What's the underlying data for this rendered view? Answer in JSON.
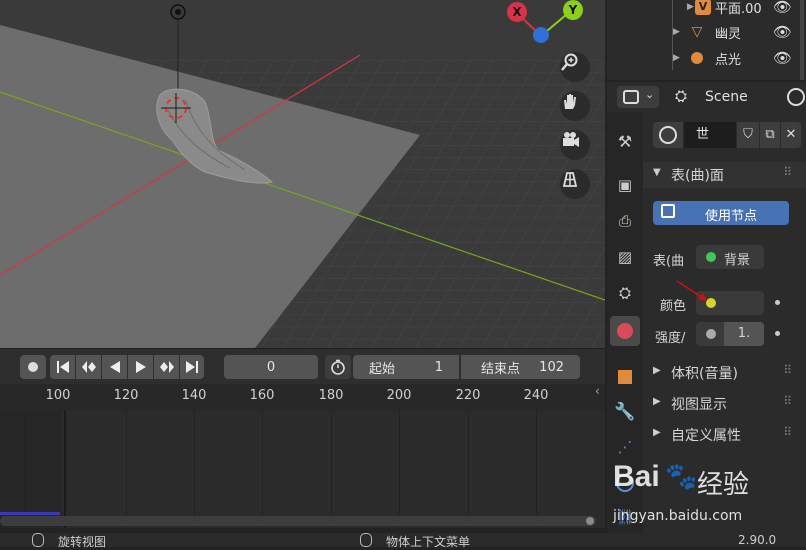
{
  "viewport": {
    "gizmo": {
      "x_label": "X",
      "y_label": "Y"
    },
    "nav_icons": [
      "zoom-icon",
      "hand-pan-icon",
      "camera-icon",
      "grid-ortho-icon"
    ]
  },
  "timeline": {
    "current_frame": "0",
    "start_label": "起始",
    "start_value": "1",
    "end_label": "结束点",
    "end_value": "102",
    "ruler_ticks": [
      "100",
      "120",
      "140",
      "160",
      "180",
      "200",
      "220",
      "240"
    ]
  },
  "outliner": {
    "items": [
      {
        "label": "平面.00",
        "icon": "mesh-icon"
      },
      {
        "label": "幽灵",
        "icon": "mesh-icon"
      },
      {
        "label": "点光",
        "icon": "light-icon"
      }
    ]
  },
  "properties": {
    "scene_label": "Scene",
    "world_name": "世",
    "surface_section": "表(曲)面",
    "use_nodes_label": "使用节点",
    "surface_label": "表(曲",
    "surface_value": "背景",
    "color_label": "颜色",
    "strength_label": "强度/",
    "strength_value": "1.",
    "volume_section": "体积(音量)",
    "viewport_display_section": "视图显示",
    "custom_props_section": "自定义属性"
  },
  "statusbar": {
    "left_text": "旋转视图",
    "middle_text": "物体上下文菜单",
    "version": "2.90.0"
  },
  "watermark": {
    "brand": "Bai",
    "brand2": "经验",
    "url": "jingyan.baidu.com"
  },
  "colors": {
    "accent_blue": "#4772b3",
    "x_axis": "#d8334a",
    "y_axis": "#8bd11b",
    "z_axis": "#2f6fd6",
    "color_swatch": "#d4d52a"
  }
}
